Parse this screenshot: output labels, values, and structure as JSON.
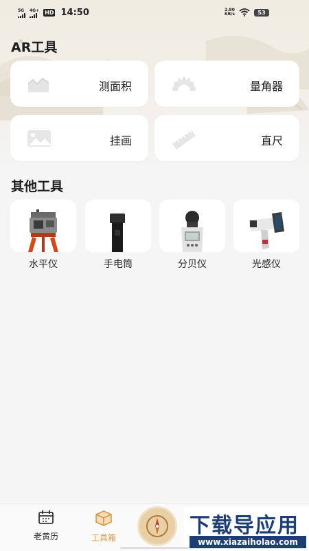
{
  "status_bar": {
    "signal1": "5G",
    "signal2": "4G+",
    "hd": "HD",
    "time": "14:50",
    "net_speed_value": "2.80",
    "net_speed_unit": "KB/s",
    "battery": "53"
  },
  "ar_section": {
    "title": "AR工具",
    "cards": [
      {
        "label": "测面积",
        "icon": "area-chart-icon"
      },
      {
        "label": "量角器",
        "icon": "protractor-icon"
      },
      {
        "label": "挂画",
        "icon": "picture-icon"
      },
      {
        "label": "直尺",
        "icon": "ruler-icon"
      }
    ]
  },
  "other_section": {
    "title": "其他工具",
    "tools": [
      {
        "label": "水平仪",
        "icon": "theodolite-icon"
      },
      {
        "label": "手电筒",
        "icon": "flashlight-icon"
      },
      {
        "label": "分贝仪",
        "icon": "decibel-meter-icon"
      },
      {
        "label": "光感仪",
        "icon": "light-meter-icon"
      }
    ]
  },
  "bottom_nav": {
    "items": [
      {
        "label": "老黄历",
        "icon": "calendar-icon"
      },
      {
        "label": "工具箱",
        "icon": "toolbox-icon",
        "active": true
      },
      {
        "label": "",
        "icon": "compass-icon"
      }
    ],
    "active_color": "#d49a4a"
  },
  "watermark": {
    "main": "下载导应用",
    "sub": "www.xiazaiholao.com"
  }
}
